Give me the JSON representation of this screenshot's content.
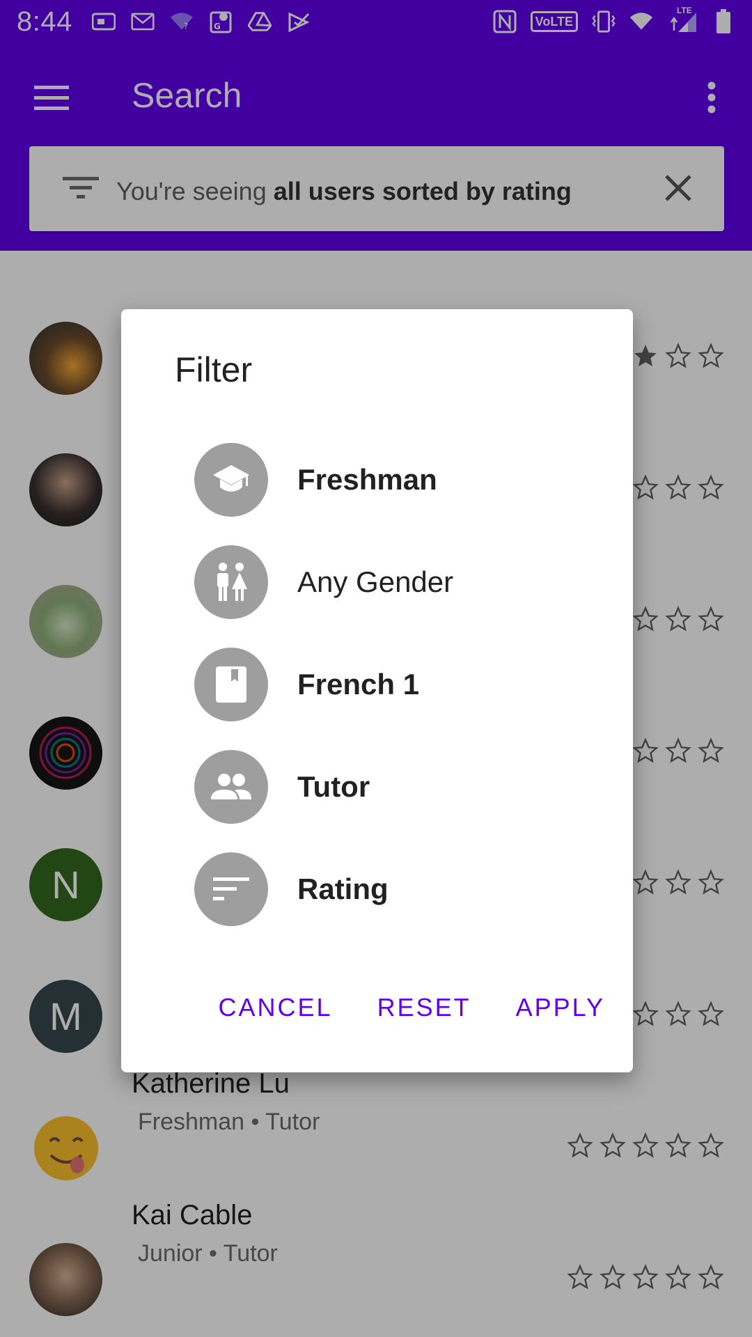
{
  "status_bar": {
    "time": "8:44",
    "left_icons": [
      "sim-card-icon",
      "gmail-icon",
      "wifi-question-icon",
      "maps-icon",
      "drive-icon",
      "tasks-icon"
    ],
    "right_icons": [
      "nfc-icon",
      "volte-icon",
      "vibrate-icon",
      "wifi-icon",
      "lte-signal-icon",
      "battery-icon"
    ],
    "volte_label": "VoLTE",
    "lte_label": "LTE"
  },
  "app_bar": {
    "title": "Search",
    "filter_prefix": "You're seeing ",
    "filter_bold": "all users sorted by rating"
  },
  "users": [
    {
      "name": "",
      "sub": "",
      "avatar_color": "#7a5a3a"
    },
    {
      "name": "",
      "sub": "",
      "avatar_color": "#3a3a3a"
    },
    {
      "name": "",
      "sub": "",
      "avatar_color": "#8fb07a"
    },
    {
      "name": "",
      "sub": "",
      "avatar_color": "#111111"
    },
    {
      "name": "",
      "sub": "",
      "avatar_letter": "N",
      "avatar_color": "#33691e"
    },
    {
      "name": "",
      "sub": "",
      "avatar_letter": "M",
      "avatar_color": "#37474f"
    },
    {
      "name": "Katherine Lu",
      "sub": "Freshman • Tutor",
      "avatar_color": "#fbc02d"
    },
    {
      "name": "Kai Cable",
      "sub": "Junior • Tutor",
      "avatar_color": "#5d4a3a"
    }
  ],
  "dialog": {
    "title": "Filter",
    "options": [
      {
        "label": "Freshman",
        "icon": "school-icon",
        "bold": true
      },
      {
        "label": "Any Gender",
        "icon": "wc-icon",
        "bold": false
      },
      {
        "label": "French 1",
        "icon": "book-icon",
        "bold": true
      },
      {
        "label": "Tutor",
        "icon": "people-icon",
        "bold": true
      },
      {
        "label": "Rating",
        "icon": "sort-icon",
        "bold": true
      }
    ],
    "cancel_label": "CANCEL",
    "reset_label": "RESET",
    "apply_label": "APPLY"
  },
  "colors": {
    "primary": "#6200ee",
    "option_icon_bg": "#9e9e9e"
  }
}
